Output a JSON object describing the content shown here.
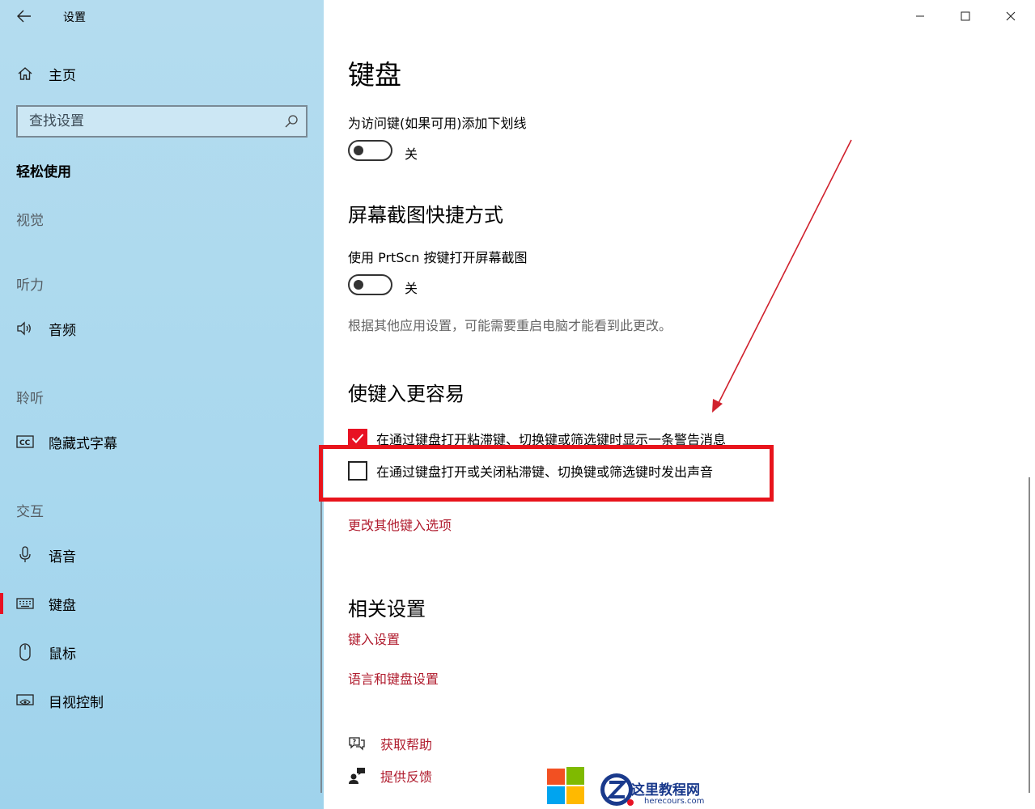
{
  "window": {
    "title": "设置"
  },
  "sidebar": {
    "home_label": "主页",
    "search_placeholder": "查找设置",
    "section_title": "轻松使用",
    "groups": {
      "vision": "视觉",
      "hearing": "听力",
      "audio": "音频",
      "listen": "聆听",
      "captions": "隐藏式字幕",
      "interaction": "交互",
      "speech": "语音",
      "keyboard": "键盘",
      "mouse": "鼠标",
      "eye_control": "目视控制"
    },
    "active_item": "键盘"
  },
  "main": {
    "title": "键盘",
    "underline_access_keys": {
      "label": "为访问键(如果可用)添加下划线",
      "state": "关",
      "on": false
    },
    "print_screen": {
      "heading": "屏幕截图快捷方式",
      "label": "使用 PrtScn 按键打开屏幕截图",
      "state": "关",
      "on": false,
      "note": "根据其他应用设置，可能需要重启电脑才能看到此更改。"
    },
    "typing_easier": {
      "heading": "使键入更容易",
      "checkbox_warning": {
        "label": "在通过键盘打开粘滞键、切换键或筛选键时显示一条警告消息",
        "checked": true
      },
      "checkbox_sound": {
        "label": "在通过键盘打开或关闭粘滞键、切换键或筛选键时发出声音",
        "checked": false
      },
      "more_link": "更改其他键入选项"
    },
    "related": {
      "heading": "相关设置",
      "typing_settings": "键入设置",
      "language_keyboard": "语言和键盘设置"
    },
    "help": {
      "get_help": "获取帮助",
      "feedback": "提供反馈"
    }
  },
  "watermark": {
    "title": "这里教程网",
    "url": "herecours.com"
  },
  "colors": {
    "accent": "#e81123",
    "link": "#b01c2e",
    "highlight": "#e8141c"
  }
}
